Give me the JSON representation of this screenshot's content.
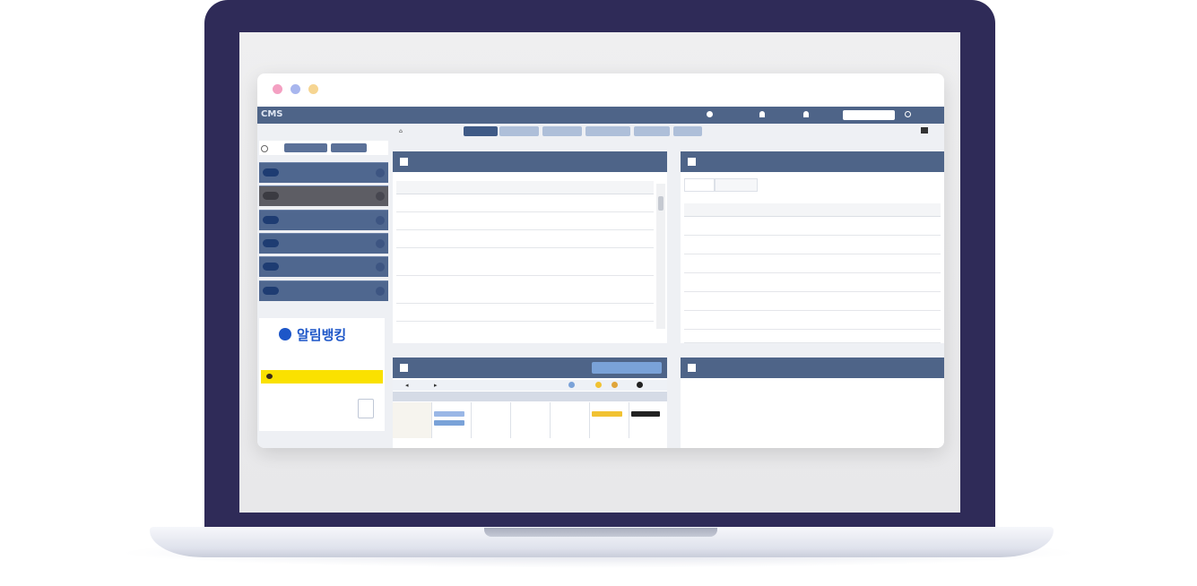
{
  "window_title": "",
  "app": {
    "logo": "CMS",
    "top_message": "",
    "top_items": [
      "",
      "",
      ""
    ],
    "search_placeholder": "",
    "search_button": ""
  },
  "tabs": {
    "home": "",
    "items": [
      "",
      "",
      "",
      "",
      "",
      ""
    ]
  },
  "sidebar": {
    "top_buttons": [
      "",
      ""
    ],
    "menus": [
      {
        "badge": "",
        "label": ""
      },
      {
        "badge": "",
        "label": ""
      },
      {
        "badge": "",
        "label": ""
      },
      {
        "badge": "",
        "label": ""
      },
      {
        "badge": "",
        "label": ""
      },
      {
        "badge": "",
        "label": ""
      }
    ],
    "banner": {
      "brand": "알림뱅킹",
      "sub": "",
      "kakao_text": "",
      "mini_line1": "",
      "mini_line2": ""
    }
  },
  "notice_panel": {
    "title": "",
    "columns": [
      "",
      "",
      ""
    ],
    "rows": [
      {
        "no": "",
        "title": "",
        "date": ""
      },
      {
        "no": "",
        "title": "",
        "date": ""
      },
      {
        "no": "",
        "title": "",
        "date": ""
      },
      {
        "no": "",
        "title": "",
        "date": ""
      },
      {
        "no": "",
        "title": "",
        "date": ""
      },
      {
        "no": "",
        "title": "",
        "date": ""
      }
    ]
  },
  "member_panel": {
    "title": "",
    "subtabs": [
      "",
      ""
    ],
    "columns": [
      "",
      "",
      "",
      ""
    ],
    "rows": [
      {
        "no": "",
        "group": "",
        "status": "",
        "count": ""
      },
      {
        "no": "",
        "group": "",
        "status": "",
        "count": ""
      },
      {
        "no": "",
        "group": "",
        "status": "",
        "count": ""
      },
      {
        "no": "",
        "group": "",
        "status": "",
        "count": ""
      },
      {
        "no": "",
        "group": "",
        "status": "",
        "count": ""
      },
      {
        "no": "",
        "group": "",
        "status": "",
        "count": ""
      },
      {
        "no": "",
        "group": "",
        "status": "",
        "count": ""
      }
    ]
  },
  "schedule_panel": {
    "title": "",
    "button": "",
    "month": "",
    "weekdays": [
      "",
      "",
      "",
      "",
      "",
      "",
      ""
    ]
  },
  "news_panel": {
    "title": "",
    "items": [
      "",
      "",
      ""
    ]
  },
  "colors": {
    "lid": "#2f2b58",
    "header": "#4e6488",
    "accent": "#1d56c8",
    "kakao": "#fae100"
  }
}
